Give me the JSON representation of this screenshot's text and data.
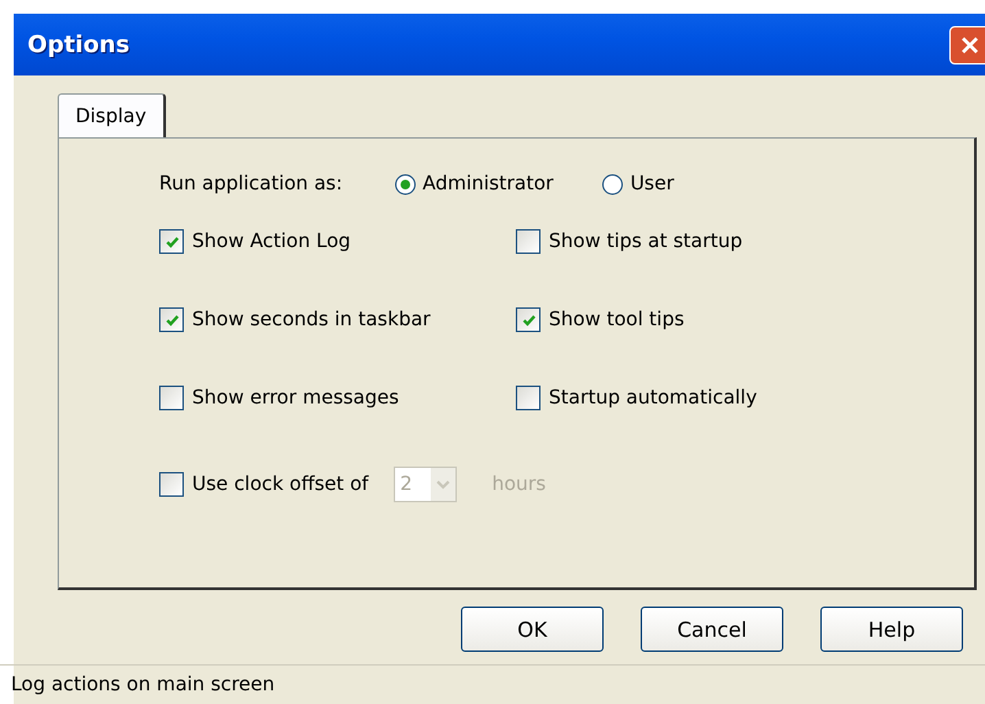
{
  "window": {
    "title": "Options"
  },
  "tabs": [
    {
      "label": "Display",
      "selected": true
    }
  ],
  "run_as": {
    "label": "Run application as:",
    "options": [
      {
        "label": "Administrator",
        "selected": true
      },
      {
        "label": "User",
        "selected": false
      }
    ]
  },
  "checkboxes": [
    {
      "label": "Show Action Log",
      "checked": true
    },
    {
      "label": "Show tips at startup",
      "checked": false
    },
    {
      "label": "Show seconds in taskbar",
      "checked": true
    },
    {
      "label": "Show tool tips",
      "checked": true
    },
    {
      "label": "Show error messages",
      "checked": false
    },
    {
      "label": "Startup automatically",
      "checked": false
    }
  ],
  "clock_offset": {
    "label": "Use clock offset of",
    "checked": false,
    "value": "2",
    "unit": "hours",
    "disabled": true
  },
  "buttons": [
    "OK",
    "Cancel",
    "Help"
  ],
  "status_bar": "Log actions on main screen"
}
